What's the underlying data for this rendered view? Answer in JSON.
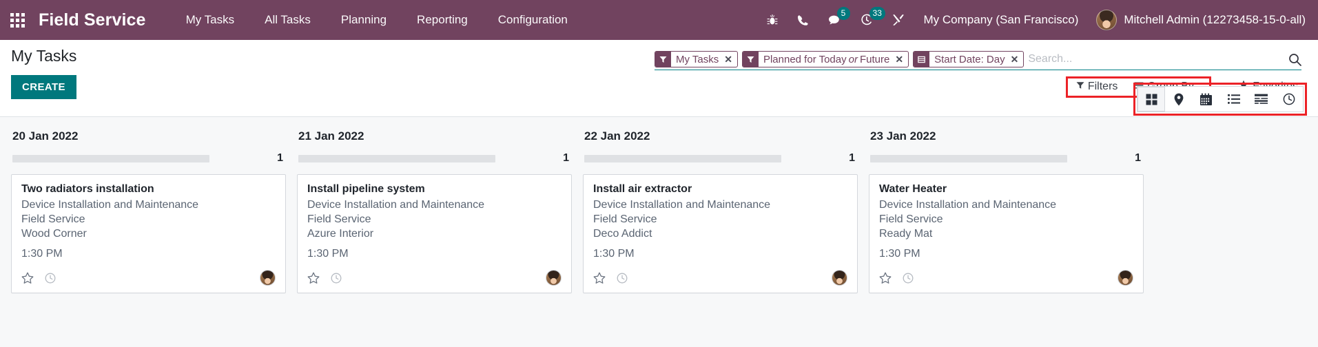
{
  "navbar": {
    "apps_icon": "apps-grid-icon",
    "brand": "Field Service",
    "menu": [
      {
        "label": "My Tasks"
      },
      {
        "label": "All Tasks"
      },
      {
        "label": "Planning"
      },
      {
        "label": "Reporting"
      },
      {
        "label": "Configuration"
      }
    ],
    "icons": [
      {
        "name": "bug-icon",
        "badge": null
      },
      {
        "name": "phone-icon",
        "badge": null
      },
      {
        "name": "chat-icon",
        "badge": "5"
      },
      {
        "name": "activity-clock-icon",
        "badge": "33"
      },
      {
        "name": "tools-icon",
        "badge": null
      }
    ],
    "company": "My Company (San Francisco)",
    "user": "Mitchell Admin (12273458-15-0-all)",
    "bg_color": "#71435f",
    "badge_color": "#00787d"
  },
  "control_panel": {
    "title": "My Tasks",
    "create_label": "CREATE",
    "create_color": "#00787d",
    "facets": [
      {
        "icon": "filter-icon",
        "label": "My Tasks",
        "remove": "×"
      },
      {
        "icon": "filter-icon",
        "label": "Planned for Today ",
        "label_em": "or",
        "label_tail": " Future",
        "remove": "×"
      },
      {
        "icon": "groupby-icon",
        "label": "Start Date: Day",
        "remove": "×"
      }
    ],
    "search": {
      "placeholder": "Search...",
      "value": "",
      "icon": "search-icon"
    },
    "dropdowns": {
      "filters_label": "Filters",
      "groupby_label": "Group By",
      "favorites_label": "Favorites"
    },
    "highlight_color": "#ec2227",
    "views": [
      {
        "name": "view-kanban",
        "icon": "kanban-grid-icon",
        "active": true
      },
      {
        "name": "view-map",
        "icon": "map-pin-icon",
        "active": false
      },
      {
        "name": "view-calendar",
        "icon": "calendar-icon",
        "active": false
      },
      {
        "name": "view-list",
        "icon": "list-icon",
        "active": false
      },
      {
        "name": "view-gantt",
        "icon": "gantt-icon",
        "active": false
      },
      {
        "name": "view-activity",
        "icon": "clock-icon",
        "active": false
      }
    ]
  },
  "kanban": {
    "columns": [
      {
        "title": "20 Jan 2022",
        "count": "1",
        "card": {
          "title": "Two radiators installation",
          "project": "Device Installation and Maintenance",
          "team": "Field Service",
          "customer": "Wood Corner",
          "time": "1:30 PM",
          "star_icon": "star-outline-icon",
          "clock_icon": "clock-outline-icon",
          "avatar": "assignee-avatar"
        }
      },
      {
        "title": "21 Jan 2022",
        "count": "1",
        "card": {
          "title": "Install pipeline system",
          "project": "Device Installation and Maintenance",
          "team": "Field Service",
          "customer": "Azure Interior",
          "time": "1:30 PM",
          "star_icon": "star-outline-icon",
          "clock_icon": "clock-outline-icon",
          "avatar": "assignee-avatar"
        }
      },
      {
        "title": "22 Jan 2022",
        "count": "1",
        "card": {
          "title": "Install air extractor",
          "project": "Device Installation and Maintenance",
          "team": "Field Service",
          "customer": "Deco Addict",
          "time": "1:30 PM",
          "star_icon": "star-outline-icon",
          "clock_icon": "clock-outline-icon",
          "avatar": "assignee-avatar"
        }
      },
      {
        "title": "23 Jan 2022",
        "count": "1",
        "card": {
          "title": "Water Heater",
          "project": "Device Installation and Maintenance",
          "team": "Field Service",
          "customer": "Ready Mat",
          "time": "1:30 PM",
          "star_icon": "star-outline-icon",
          "clock_icon": "clock-outline-icon",
          "avatar": "assignee-avatar"
        }
      }
    ]
  }
}
